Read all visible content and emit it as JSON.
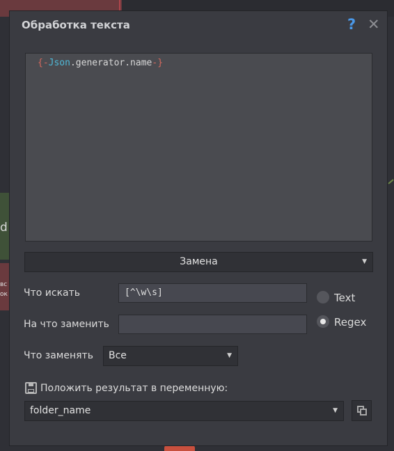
{
  "dialog": {
    "title": "Обработка текста",
    "help_icon": "?",
    "close_icon": "✕"
  },
  "editor": {
    "content_parts": [
      "{-",
      "Json",
      ".generator.name",
      "-}"
    ]
  },
  "mode_select": {
    "value": "Замена"
  },
  "search": {
    "label": "Что искать",
    "value": "[^\\w\\s]"
  },
  "replace": {
    "label": "На что заменить",
    "value": ""
  },
  "radio": {
    "text_label": "Text",
    "regex_label": "Regex",
    "selected": "Regex"
  },
  "which": {
    "label": "Что заменять",
    "value": "Все"
  },
  "result": {
    "label": "Положить результат в переменную:",
    "value": "folder_name"
  },
  "background": {
    "letter": "d",
    "tiny1": "вс",
    "tiny2": "ок"
  },
  "colors": {
    "accent": "#4a98e8",
    "dialog_bg": "#3a3b41",
    "editor_bg": "#4a4b50"
  }
}
